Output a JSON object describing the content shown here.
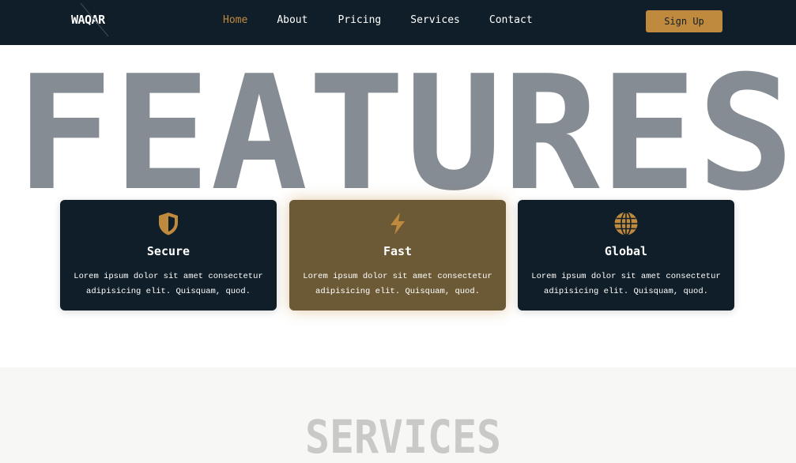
{
  "nav": {
    "logo": "WAQAR",
    "links": [
      "Home",
      "About",
      "Pricing",
      "Services",
      "Contact"
    ],
    "active": "Home",
    "signup": "Sign Up"
  },
  "features": {
    "heading": "FEATURES",
    "cards": [
      {
        "icon": "shield-icon",
        "title": "Secure",
        "text": "Lorem ipsum dolor sit amet consectetur adipisicing elit. Quisquam, quod."
      },
      {
        "icon": "bolt-icon",
        "title": "Fast",
        "text": "Lorem ipsum dolor sit amet consectetur adipisicing elit. Quisquam, quod."
      },
      {
        "icon": "globe-icon",
        "title": "Global",
        "text": "Lorem ipsum dolor sit amet consectetur adipisicing elit. Quisquam, quod."
      }
    ]
  },
  "services": {
    "heading": "SERVICES"
  },
  "colors": {
    "navy": "#0f1e28",
    "accent": "#c08a3e",
    "highlight_card": "#6b5a35",
    "heading_gray": "#858c93"
  }
}
